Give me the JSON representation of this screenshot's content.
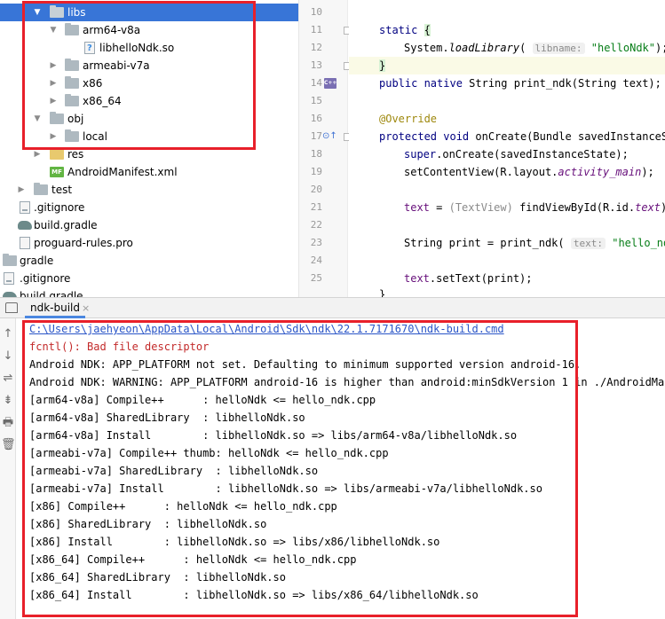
{
  "tree": {
    "items": [
      {
        "label": "libs",
        "kind": "folder",
        "arrow": "▼",
        "selected": true
      },
      {
        "label": "arm64-v8a",
        "kind": "folder",
        "arrow": "▼"
      },
      {
        "label": "libhelloNdk.so",
        "kind": "unknown-file",
        "arrow": ""
      },
      {
        "label": "armeabi-v7a",
        "kind": "folder",
        "arrow": "▶"
      },
      {
        "label": "x86",
        "kind": "folder",
        "arrow": "▶"
      },
      {
        "label": "x86_64",
        "kind": "folder",
        "arrow": "▶"
      },
      {
        "label": "obj",
        "kind": "folder",
        "arrow": "▼"
      },
      {
        "label": "local",
        "kind": "folder",
        "arrow": "▶"
      },
      {
        "label": "res",
        "kind": "folder",
        "arrow": "▶"
      },
      {
        "label": "AndroidManifest.xml",
        "kind": "manifest",
        "arrow": ""
      },
      {
        "label": "test",
        "kind": "folder",
        "arrow": "▶"
      },
      {
        "label": ".gitignore",
        "kind": "gitignore",
        "arrow": ""
      },
      {
        "label": "build.gradle",
        "kind": "gradle",
        "arrow": ""
      },
      {
        "label": "proguard-rules.pro",
        "kind": "file",
        "arrow": ""
      },
      {
        "label": "gradle",
        "kind": "folder",
        "arrow": ""
      },
      {
        "label": ".gitignore",
        "kind": "gitignore",
        "arrow": ""
      },
      {
        "label": "build.gradle",
        "kind": "gradle",
        "arrow": ""
      }
    ]
  },
  "editor": {
    "line_numbers": [
      "10",
      "11",
      "12",
      "13",
      "14",
      "15",
      "16",
      "17",
      "18",
      "19",
      "20",
      "21",
      "22",
      "23",
      "24",
      "25"
    ],
    "code": {
      "l11_kw": "static",
      "l11_brace": "{",
      "l12_call": "System.",
      "l12_method": "loadLibrary",
      "l12_open": "(",
      "l12_param": "libname:",
      "l12_str": "\"helloNdk\"",
      "l12_close": ");",
      "l13_brace": "}",
      "l14_kw": "public native",
      "l14_rest": " String print_ndk(String text);",
      "l16_ann": "@Override",
      "l17_kw": "protected void",
      "l17_rest": " onCreate(Bundle savedInstanceSt",
      "l18_kw": "super",
      "l18_rest": ".onCreate(savedInstanceState);",
      "l19_a": "setContentView(R.layout.",
      "l19_field": "activity_main",
      "l19_b": ");",
      "l21_field": "text",
      "l21_a": " = ",
      "l21_cast": "(TextView)",
      "l21_b": " findViewById(R.id.",
      "l21_field2": "text",
      "l21_c": ");",
      "l23_a": "String print = print_ndk(",
      "l23_param": "text:",
      "l23_str": "\"hello_ndk\"",
      "l23_b": ")",
      "l25_field": "text",
      "l25_a": ".setText(print);",
      "l26": "}"
    }
  },
  "bottom": {
    "tab_label": "ndk-build",
    "tab_close": "×",
    "tools": [
      "↑",
      "↓",
      "⇌",
      "⇟",
      "🖶",
      "🗑"
    ]
  },
  "console": {
    "lines": [
      {
        "text": "C:\\Users\\jaehyeon\\AppData\\Local\\Android\\Sdk\\ndk\\22.1.7171670\\ndk-build.cmd",
        "style": "link"
      },
      {
        "text": "fcntl(): Bad file descriptor",
        "style": "err"
      },
      {
        "text": "Android NDK: APP_PLATFORM not set. Defaulting to minimum supported version android-16.",
        "style": ""
      },
      {
        "text": "Android NDK: WARNING: APP_PLATFORM android-16 is higher than android:minSdkVersion 1 in ./AndroidManife",
        "style": ""
      },
      {
        "text": "[arm64-v8a] Compile++      : helloNdk <= hello_ndk.cpp",
        "style": ""
      },
      {
        "text": "[arm64-v8a] SharedLibrary  : libhelloNdk.so",
        "style": ""
      },
      {
        "text": "[arm64-v8a] Install        : libhelloNdk.so => libs/arm64-v8a/libhelloNdk.so",
        "style": ""
      },
      {
        "text": "[armeabi-v7a] Compile++ thumb: helloNdk <= hello_ndk.cpp",
        "style": ""
      },
      {
        "text": "[armeabi-v7a] SharedLibrary  : libhelloNdk.so",
        "style": ""
      },
      {
        "text": "[armeabi-v7a] Install        : libhelloNdk.so => libs/armeabi-v7a/libhelloNdk.so",
        "style": ""
      },
      {
        "text": "[x86] Compile++      : helloNdk <= hello_ndk.cpp",
        "style": ""
      },
      {
        "text": "[x86] SharedLibrary  : libhelloNdk.so",
        "style": ""
      },
      {
        "text": "[x86] Install        : libhelloNdk.so => libs/x86/libhelloNdk.so",
        "style": ""
      },
      {
        "text": "[x86_64] Compile++      : helloNdk <= hello_ndk.cpp",
        "style": ""
      },
      {
        "text": "[x86_64] SharedLibrary  : libhelloNdk.so",
        "style": ""
      },
      {
        "text": "[x86_64] Install        : libhelloNdk.so => libs/x86_64/libhelloNdk.so",
        "style": ""
      }
    ]
  },
  "colors": {
    "selection": "#3875d7",
    "highlight_box": "#e8202a",
    "keyword": "#000080",
    "string": "#067d17",
    "link": "#2a55c7",
    "error": "#c32a2a"
  }
}
